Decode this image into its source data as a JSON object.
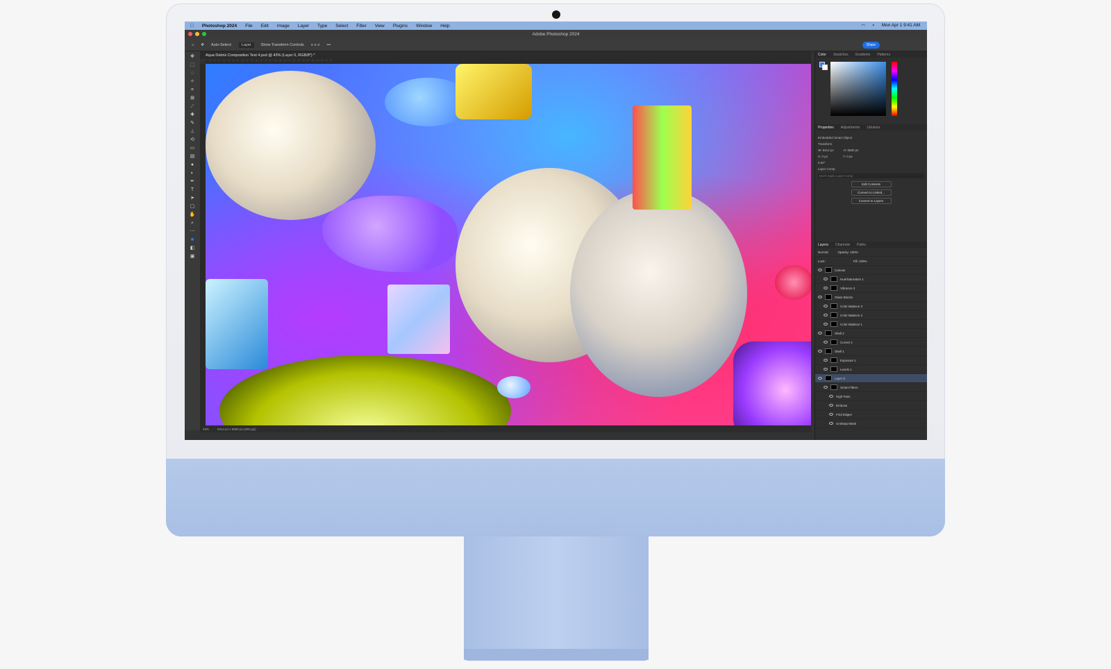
{
  "menubar": {
    "app": "Photoshop 2024",
    "items": [
      "File",
      "Edit",
      "Image",
      "Layer",
      "Type",
      "Select",
      "Filter",
      "View",
      "Plugins",
      "Window",
      "Help"
    ],
    "clock": "Mon Apr 1  9:41 AM"
  },
  "window": {
    "title": "Adobe Photoshop 2024",
    "share": "Share"
  },
  "options": {
    "auto_select": "Auto-Select:",
    "layer_select": "Layer",
    "transform_controls": "Show Transform Controls"
  },
  "document_tab": "Aqua Debris Composition Test 4.psd @ 43% (Layer 0, RGB/8*) *",
  "status": {
    "zoom": "43%",
    "size": "9414 px x 5580 px (300 ppi)"
  },
  "color_panel": {
    "tabs": [
      "Color",
      "Swatches",
      "Gradients",
      "Patterns"
    ],
    "fg": "#2f7cf6"
  },
  "properties": {
    "tabs": [
      "Properties",
      "Adjustments",
      "Libraries"
    ],
    "type": "Embedded Smart Object",
    "transform": "Transform",
    "w": "W: 9414 px",
    "h": "H: 5580 px",
    "x": "X: 0 px",
    "y": "Y: 0 px",
    "angle": "0.00°",
    "comp_label": "Layer Comp",
    "comp_value": "Don't Apply Layer Comp",
    "buttons": [
      "Edit Contents",
      "Convert to Linked...",
      "Convert to Layers"
    ]
  },
  "layers_panel": {
    "tabs": [
      "Layers",
      "Channels",
      "Paths"
    ],
    "blend": "Normal",
    "opacity": "Opacity: 100%",
    "lock": "Lock:",
    "fill": "Fill: 100%",
    "items": [
      {
        "name": "Canvas",
        "level": 0
      },
      {
        "name": "Hue/Saturation 1",
        "level": 1
      },
      {
        "name": "Vibrance 2",
        "level": 1
      },
      {
        "name": "Glass Blocks",
        "level": 0
      },
      {
        "name": "Color Balance 3",
        "level": 1
      },
      {
        "name": "Color Balance 2",
        "level": 1
      },
      {
        "name": "Color Balance 1",
        "level": 1
      },
      {
        "name": "Shell 2",
        "level": 0
      },
      {
        "name": "Curves 1",
        "level": 1
      },
      {
        "name": "Shell 1",
        "level": 0
      },
      {
        "name": "Exposure 1",
        "level": 1
      },
      {
        "name": "Levels 1",
        "level": 1
      },
      {
        "name": "Layer 0",
        "level": 0,
        "selected": true
      },
      {
        "name": "Smart Filters",
        "level": 1
      },
      {
        "name": "High Pass",
        "level": 2
      },
      {
        "name": "Emboss",
        "level": 2
      },
      {
        "name": "Find Edges",
        "level": 2
      },
      {
        "name": "Unsharp Mask",
        "level": 2
      }
    ]
  }
}
